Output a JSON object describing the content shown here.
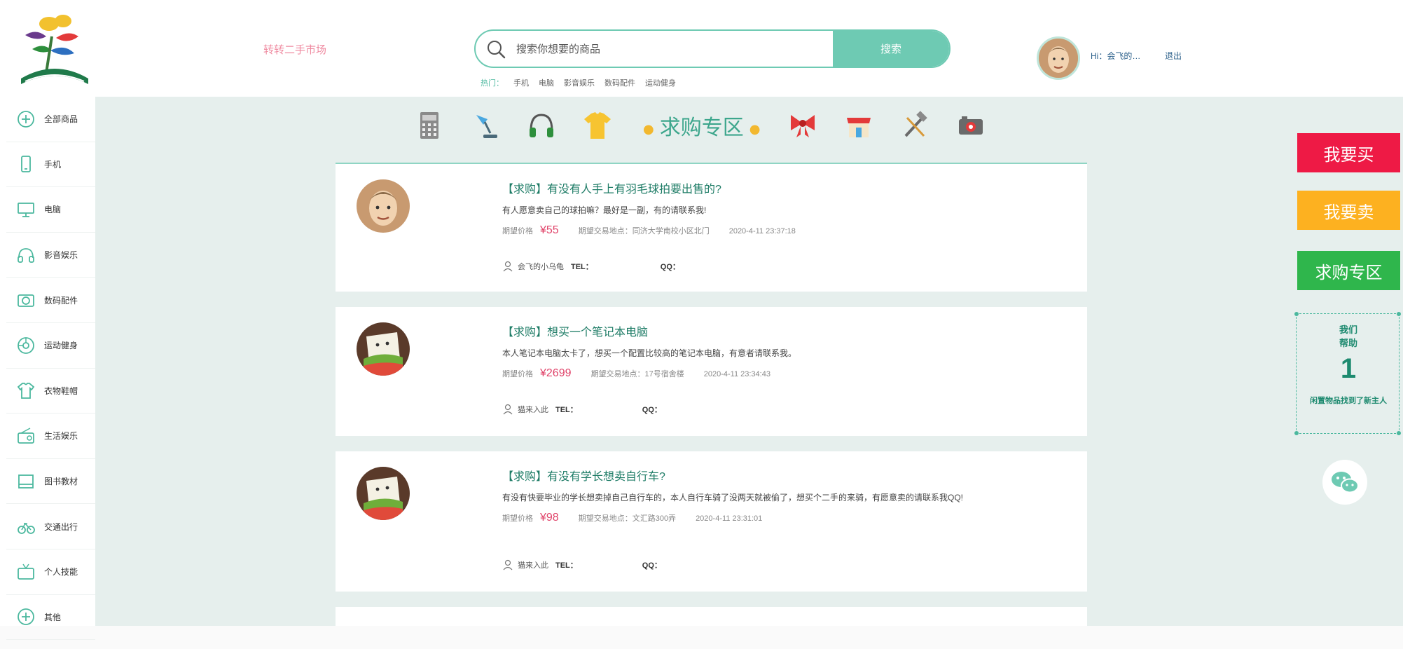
{
  "header": {
    "site_name": "转转二手市场",
    "search": {
      "placeholder": "搜索你想要的商品",
      "button_label": "搜索"
    },
    "hot_tags": [
      "热门：",
      "手机",
      "电脑",
      "影音娱乐",
      "数码配件",
      "运动健身"
    ],
    "user": {
      "greeting": "Hi：会飞的…",
      "logout": "退出"
    }
  },
  "sidebar": {
    "items": [
      {
        "label": "全部商品",
        "icon": "plus-circle-icon"
      },
      {
        "label": "手机",
        "icon": "phone-icon"
      },
      {
        "label": "电脑",
        "icon": "monitor-icon"
      },
      {
        "label": "影音娱乐",
        "icon": "headphones-icon"
      },
      {
        "label": "数码配件",
        "icon": "camera-icon"
      },
      {
        "label": "运动健身",
        "icon": "ball-icon"
      },
      {
        "label": "衣物鞋帽",
        "icon": "shirt-icon"
      },
      {
        "label": "生活娱乐",
        "icon": "radio-icon"
      },
      {
        "label": "图书教材",
        "icon": "book-icon"
      },
      {
        "label": "交通出行",
        "icon": "bike-icon"
      },
      {
        "label": "个人技能",
        "icon": "tv-icon"
      },
      {
        "label": "其他",
        "icon": "plus-circle-icon"
      }
    ]
  },
  "category_bar": {
    "title": "求购专区",
    "left_icons": [
      "calculator-icon",
      "desk-lamp-icon",
      "headphones-icon",
      "tshirt-icon"
    ],
    "right_icons": [
      "bow-icon",
      "store-icon",
      "tools-icon",
      "camera-icon"
    ]
  },
  "posts": [
    {
      "title": "【求购】有没有人手上有羽毛球拍要出售的?",
      "desc": "有人愿意卖自己的球拍嘛？最好是一副，有的请联系我!",
      "price_label": "期望价格",
      "price": "¥55",
      "location": "期望交易地点：同济大学南校小区北门",
      "time": "2020-4-11 23:37:18",
      "user": "会飞的小乌龟",
      "tel_label": "TEL：",
      "qq_label": "QQ：",
      "avatar": "avatar-man-icon"
    },
    {
      "title": "【求购】想买一个笔记本电脑",
      "desc": "本人笔记本电脑太卡了，想买一个配置比较高的笔记本电脑，有意者请联系我。",
      "price_label": "期望价格",
      "price": "¥2699",
      "location": "期望交易地点：17号宿舍楼",
      "time": "2020-4-11 23:34:43",
      "user": "猫来入此",
      "tel_label": "TEL：",
      "qq_label": "QQ：",
      "avatar": "avatar-sandwich-icon"
    },
    {
      "title": "【求购】有没有学长想卖自行车?",
      "desc": "有没有快要毕业的学长想卖掉自己自行车的，本人自行车骑了没两天就被偷了，想买个二手的来骑，有愿意卖的请联系我QQ!",
      "price_label": "期望价格",
      "price": "¥98",
      "location": "期望交易地点：文汇路300弄",
      "time": "2020-4-11 23:31:01",
      "user": "猫来入此",
      "tel_label": "TEL：",
      "qq_label": "QQ：",
      "avatar": "avatar-sandwich-icon"
    }
  ],
  "right_panel": {
    "buy": "我要买",
    "sell": "我要卖",
    "want": "求购专区",
    "stats_label_1": "我们",
    "stats_label_2": "帮助",
    "stats_number": "1",
    "stats_desc": "闲置物品找到了新主人"
  },
  "colors": {
    "accent": "#6ecab3",
    "buy": "#ee1a45",
    "sell": "#fdb120",
    "want": "#2fb64c",
    "price": "#e0446a"
  }
}
